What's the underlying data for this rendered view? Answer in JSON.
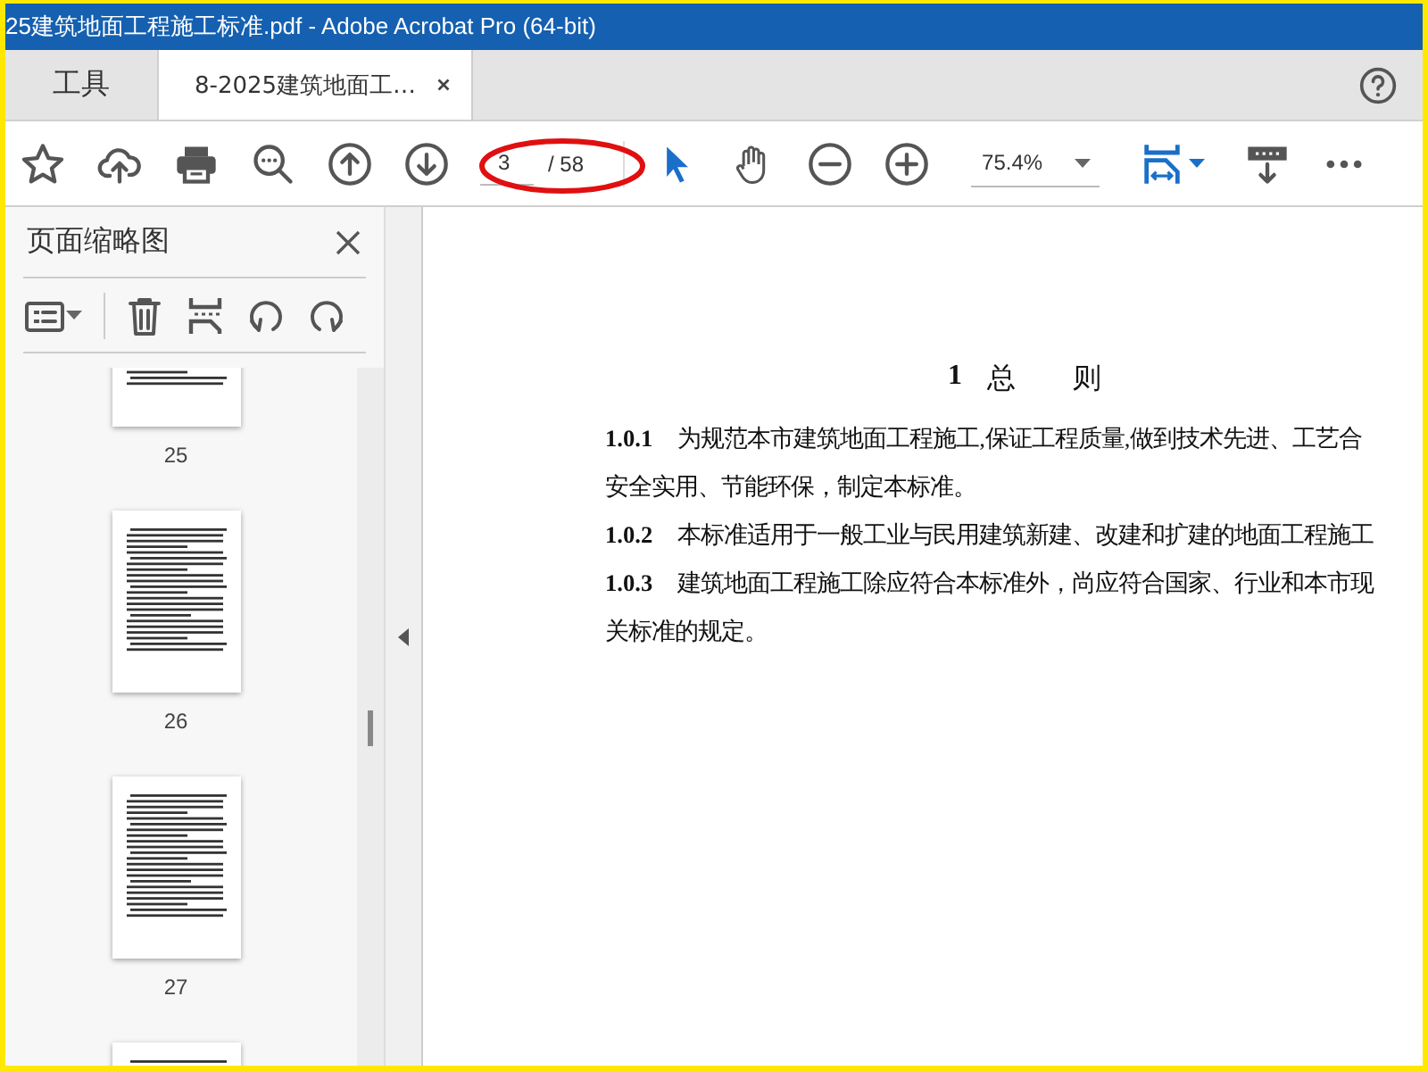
{
  "window": {
    "title": "25建筑地面工程施工标准.pdf - Adobe Acrobat Pro (64-bit)"
  },
  "tabs": [
    {
      "label": "工具",
      "selected": false,
      "closable": false
    },
    {
      "label": "8-2025建筑地面工…",
      "selected": true,
      "closable": true
    }
  ],
  "toolbar": {
    "page_field": {
      "value": "3"
    },
    "page_total": "/ 58",
    "zoom_field": {
      "value": "75.4%"
    }
  },
  "sidebar": {
    "title": "页面缩略图",
    "thumbnails": [
      {
        "kind": "page",
        "label": "25"
      },
      {
        "kind": "page",
        "label": "26"
      },
      {
        "kind": "page",
        "label": "27"
      },
      {
        "kind": "cut"
      }
    ]
  },
  "document": {
    "heading_number": "1",
    "heading_title": "总　　则",
    "clauses": [
      {
        "number": "1.0.1",
        "lines": [
          "为规范本市建筑地面工程施工,保证工程质量,做到技术先进、工艺合",
          "安全实用、节能环保，制定本标准。"
        ]
      },
      {
        "number": "1.0.2",
        "lines": [
          "本标准适用于一般工业与民用建筑新建、改建和扩建的地面工程施工"
        ]
      },
      {
        "number": "1.0.3",
        "lines": [
          "建筑地面工程施工除应符合本标准外，尚应符合国家、行业和本市现",
          "关标准的规定。"
        ]
      }
    ]
  }
}
